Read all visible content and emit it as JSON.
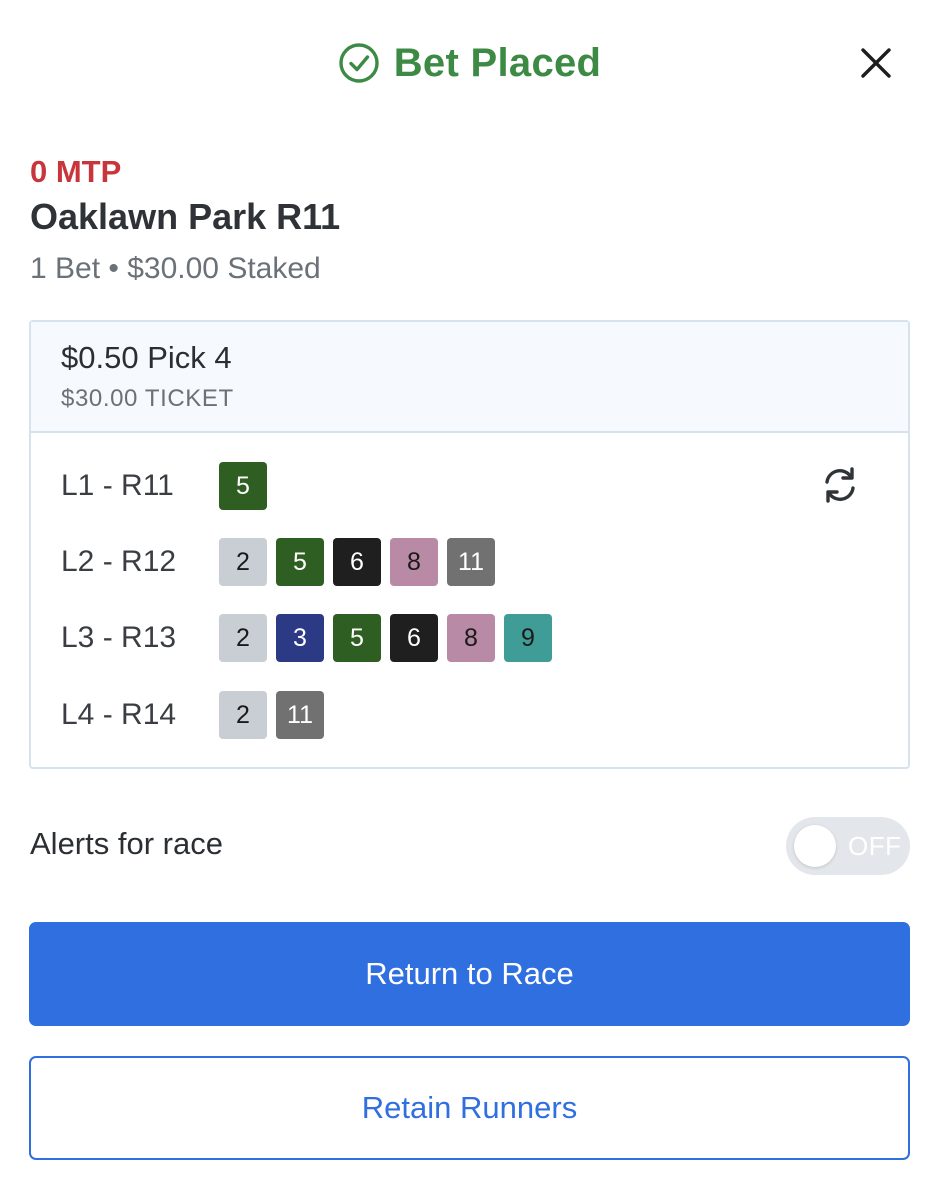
{
  "header": {
    "title": "Bet Placed",
    "status_icon": "check-circle-icon",
    "close_icon": "close-icon",
    "accent_color": "#3c8a43"
  },
  "race": {
    "mtp": "0 MTP",
    "track": "Oaklawn Park R11",
    "summary": "1 Bet • $30.00 Staked"
  },
  "ticket": {
    "bet_type": "$0.50 Pick 4",
    "cost": "$30.00 TICKET",
    "refresh_icon": "repeat-icon",
    "legs": [
      {
        "label": "L1 - R11",
        "runners": [
          {
            "n": "5",
            "bg": "#2f5e22",
            "fg": "#ffffff"
          }
        ]
      },
      {
        "label": "L2 - R12",
        "runners": [
          {
            "n": "2",
            "bg": "#c8ced3",
            "fg": "#1a1a1a"
          },
          {
            "n": "5",
            "bg": "#2f5e22",
            "fg": "#ffffff"
          },
          {
            "n": "6",
            "bg": "#1f1f1f",
            "fg": "#ffffff"
          },
          {
            "n": "8",
            "bg": "#b98aa6",
            "fg": "#1a1a1a"
          },
          {
            "n": "11",
            "bg": "#717171",
            "fg": "#ffffff"
          }
        ]
      },
      {
        "label": "L3 - R13",
        "runners": [
          {
            "n": "2",
            "bg": "#c8ced3",
            "fg": "#1a1a1a"
          },
          {
            "n": "3",
            "bg": "#2c3a86",
            "fg": "#ffffff"
          },
          {
            "n": "5",
            "bg": "#2f5e22",
            "fg": "#ffffff"
          },
          {
            "n": "6",
            "bg": "#1f1f1f",
            "fg": "#ffffff"
          },
          {
            "n": "8",
            "bg": "#b98aa6",
            "fg": "#1a1a1a"
          },
          {
            "n": "9",
            "bg": "#3f9c96",
            "fg": "#1a1a1a"
          }
        ]
      },
      {
        "label": "L4 - R14",
        "runners": [
          {
            "n": "2",
            "bg": "#c8ced3",
            "fg": "#1a1a1a"
          },
          {
            "n": "11",
            "bg": "#717171",
            "fg": "#ffffff"
          }
        ]
      }
    ]
  },
  "alerts": {
    "label": "Alerts for race",
    "toggle_state": "OFF"
  },
  "actions": {
    "primary_label": "Return to Race",
    "secondary_label": "Retain Runners",
    "button_color": "#2f6fe0"
  }
}
